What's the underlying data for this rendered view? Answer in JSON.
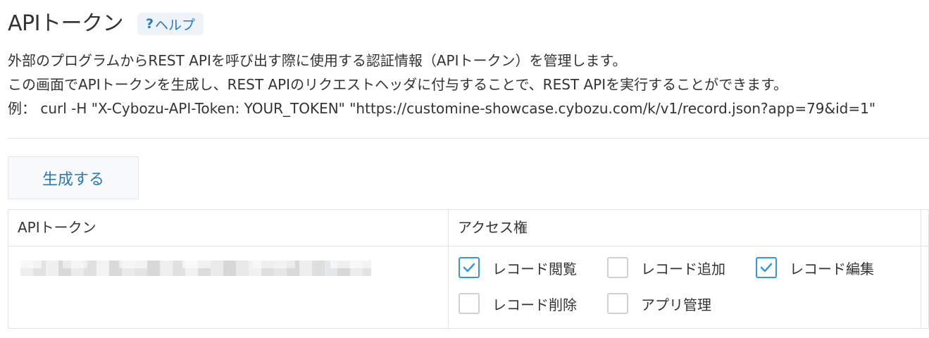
{
  "page": {
    "title": "APIトークン",
    "help": {
      "q": "?",
      "label": "ヘルプ"
    }
  },
  "description": {
    "line1": "外部のプログラムからREST APIを呼び出す際に使用する認証情報（APIトークン）を管理します。",
    "line2": "この画面でAPIトークンを生成し、REST APIのリクエストヘッダに付与することで、REST APIを実行することができます。",
    "line3": "例： curl -H \"X-Cybozu-API-Token: YOUR_TOKEN\" \"https://customine-showcase.cybozu.com/k/v1/record.json?app=79&id=1\""
  },
  "toolbar": {
    "generate_label": "生成する"
  },
  "table": {
    "col_token": "APIトークン",
    "col_access": "アクセス権",
    "rows": [
      {
        "token_masked": true,
        "permissions": [
          {
            "label": "レコード閲覧",
            "checked": true
          },
          {
            "label": "レコード追加",
            "checked": false
          },
          {
            "label": "レコード編集",
            "checked": true
          },
          {
            "label": "レコード削除",
            "checked": false
          },
          {
            "label": "アプリ管理",
            "checked": false
          }
        ]
      }
    ]
  },
  "colors": {
    "accent": "#2a7ab8",
    "checkbox_checked": "#3498db",
    "border": "#e3e3e3"
  }
}
